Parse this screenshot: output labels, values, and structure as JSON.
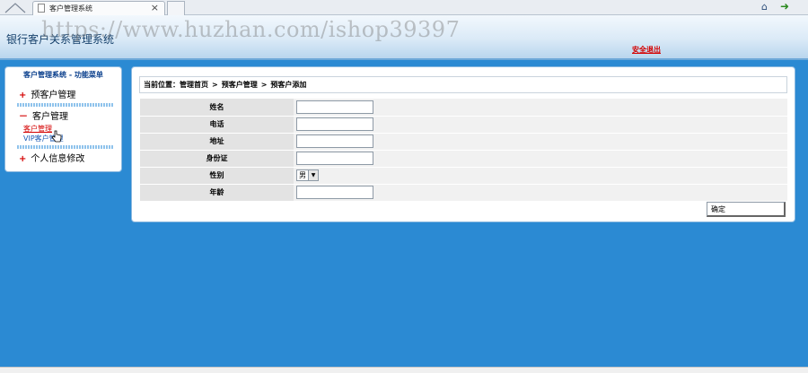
{
  "browser": {
    "tab_title": "客户管理系统",
    "close_glyph": "×",
    "icons": [
      "home-icon",
      "document-icon",
      "close-icon",
      "page-icon",
      "back-arrow-icon"
    ]
  },
  "header": {
    "title": "银行客户关系管理系统",
    "watermark": "https://www.huzhan.com/ishop39397",
    "logout_label": "安全退出"
  },
  "sidebar": {
    "heading": "客户管理系统 - 功能菜单",
    "menu": [
      {
        "symbol": "+",
        "label": "预客户管理"
      },
      {
        "symbol": "－",
        "label": "客户管理",
        "children": [
          "客户管理",
          "VIP客户管理"
        ]
      },
      {
        "symbol": "+",
        "label": "个人信息修改"
      }
    ]
  },
  "breadcrumb": {
    "prefix": "当前位置：",
    "items": [
      "管理首页",
      "预客户管理",
      "预客户添加"
    ],
    "separator": ">"
  },
  "form": {
    "fields": [
      {
        "label": "姓名",
        "value": ""
      },
      {
        "label": "电话",
        "value": ""
      },
      {
        "label": "地址",
        "value": ""
      },
      {
        "label": "身份证",
        "value": ""
      },
      {
        "label": "性别",
        "value": "男"
      },
      {
        "label": "年龄",
        "value": ""
      }
    ],
    "submit_label": "确定"
  },
  "colors": {
    "page_bg": "#2b8ad3",
    "accent_red": "#d40000",
    "link_blue": "#1a5ab5",
    "title_blue": "#15406b"
  }
}
